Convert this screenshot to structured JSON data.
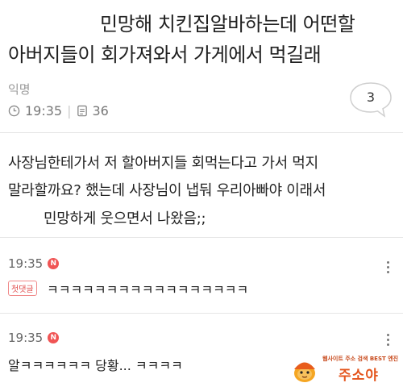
{
  "post": {
    "title_line1": "민망해 치킨집알바하는데 어떤할",
    "title_line2": "아버지들이 회가져와서 가게에서 먹길래",
    "author": "익명",
    "time": "19:35",
    "views": "36",
    "comment_count": "3",
    "body_line1": "사장님한테가서 저 할아버지들 회먹는다고 가서 먹지",
    "body_line2": "말라할까요? 했는데 사장님이 냅둬 우리아빠야 이래서",
    "body_line3": "민망하게     웃으면서 나왔음;;"
  },
  "comments": [
    {
      "time": "19:35",
      "badge": "N",
      "first_label": "첫댓글",
      "text": "ㅋㅋㅋㅋㅋㅋㅋㅋㅋㅋㅋㅋㅋㅋㅋㅋㅋ"
    },
    {
      "time": "19:35",
      "badge": "N",
      "text": "알ㅋㅋㅋㅋㅋㅋ 당황... ㅋㅋㅋㅋ"
    }
  ],
  "watermark": {
    "small_text": "웹사이트 주소 검색 BEST 엔진",
    "big_text": "주소야"
  }
}
